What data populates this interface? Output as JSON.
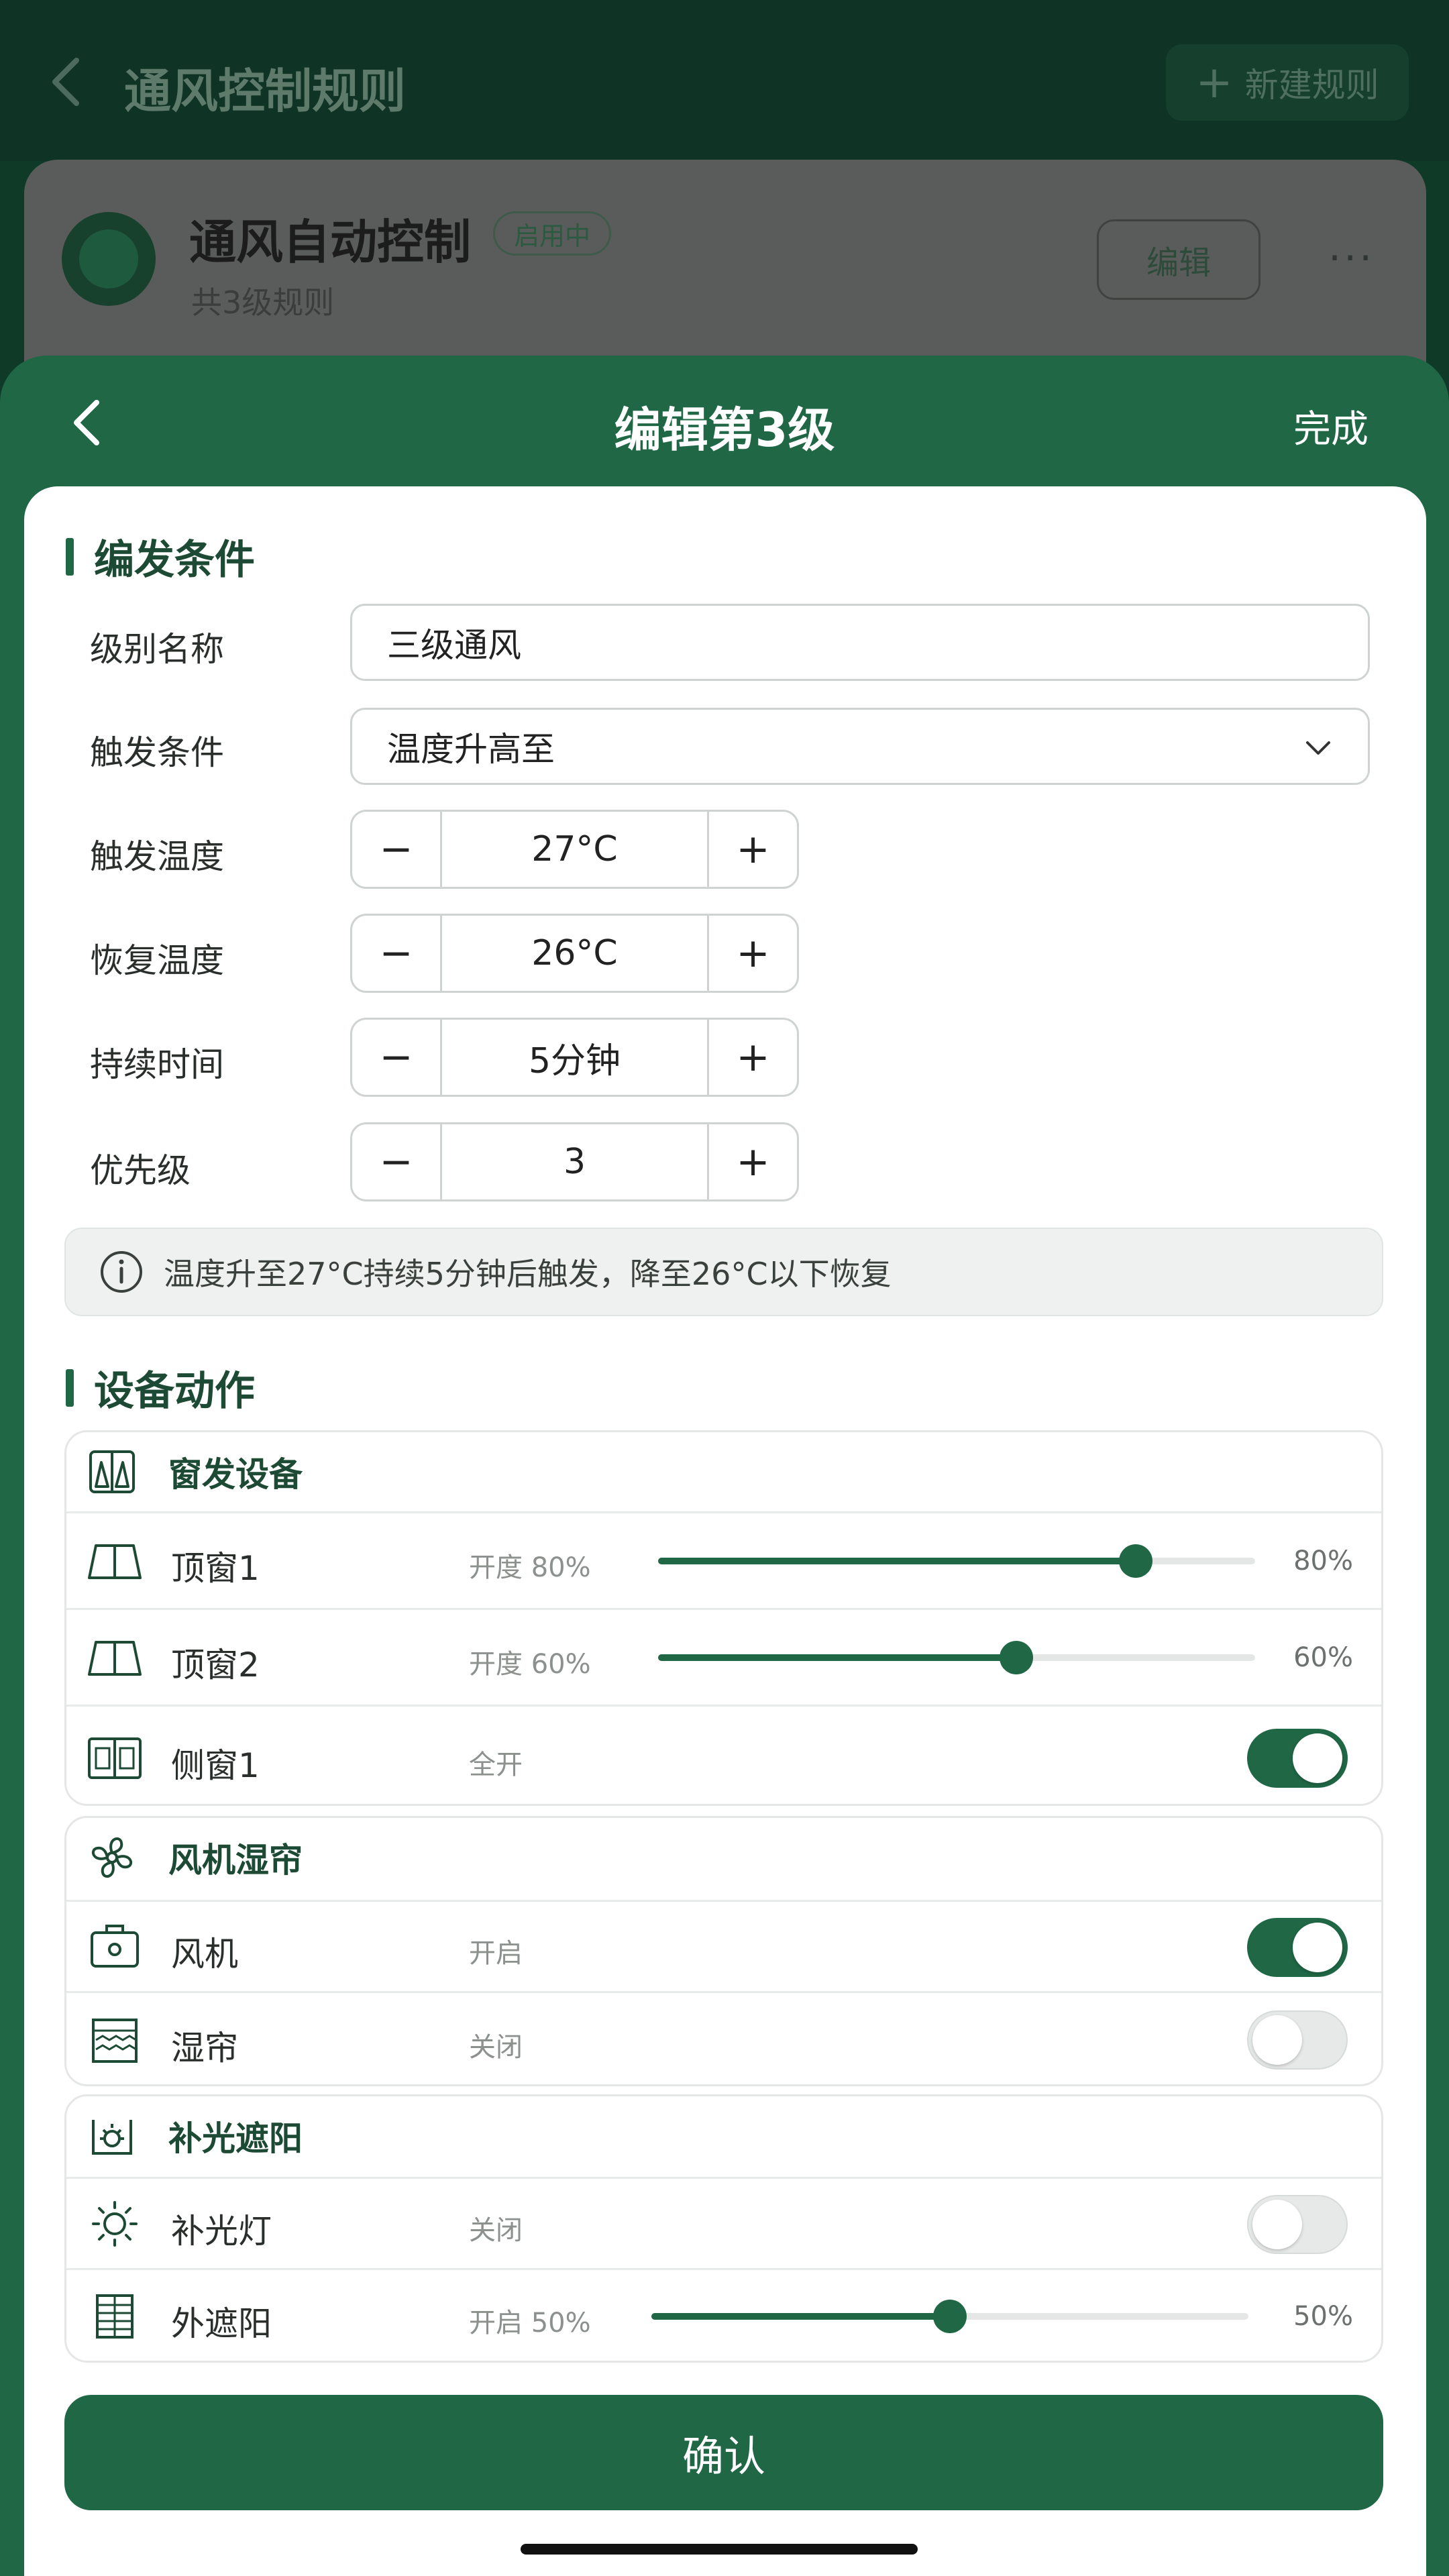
{
  "background": {
    "title": "通风控制规则",
    "new_button": "新建规则",
    "card": {
      "title": "通风自动控制",
      "badge": "启用中",
      "subtitle": "共3级规则",
      "edit_button": "编辑",
      "more": "···"
    }
  },
  "sheet": {
    "title": "编辑第3级",
    "done": "完成"
  },
  "trigger": {
    "section_title": "编发条件",
    "level_name_label": "级别名称",
    "level_name_value": "三级通风",
    "condition_label": "触发条件",
    "condition_value": "温度升高至",
    "trigger_temp_label": "触发温度",
    "trigger_temp_value": "27°C",
    "recover_temp_label": "恢复温度",
    "recover_temp_value": "26°C",
    "duration_label": "持续时间",
    "duration_value": "5分钟",
    "priority_label": "优先级",
    "priority_value": "3",
    "minus": "−",
    "plus": "+",
    "hint": "温度升至27°C持续5分钟后触发，降至26°C以下恢复"
  },
  "actions": {
    "section_title": "设备动作",
    "windows": {
      "title": "窗发设备",
      "items": [
        {
          "name": "顶窗1",
          "state": "开度  80%",
          "value": 80,
          "percent": "80%"
        },
        {
          "name": "顶窗2",
          "state": "开度  60%",
          "value": 60,
          "percent": "60%"
        },
        {
          "name": "侧窗1",
          "state": "全开",
          "on": true
        }
      ]
    },
    "fans": {
      "title": "风机湿帘",
      "items": [
        {
          "name": "风机",
          "state": "开启",
          "on": true
        },
        {
          "name": "湿帘",
          "state": "关闭",
          "on": false
        }
      ]
    },
    "light": {
      "title": "补光遮阳",
      "items": [
        {
          "name": "补光灯",
          "state": "关闭",
          "on": false
        },
        {
          "name": "外遮阳",
          "state": "开启  50%",
          "value": 50,
          "percent": "50%"
        }
      ]
    }
  },
  "confirm_button": "确认",
  "colors": {
    "primary": "#1f6745",
    "header_dark": "#0f3324"
  }
}
